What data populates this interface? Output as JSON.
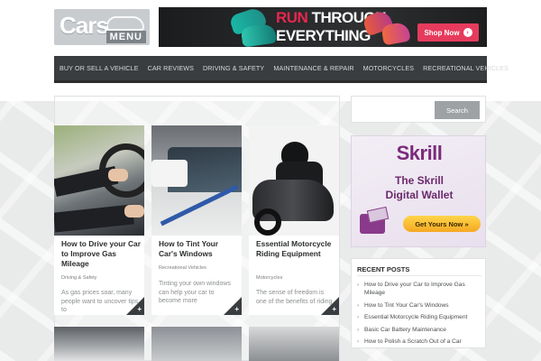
{
  "header": {
    "logo": {
      "word1": "Cars",
      "word2": "MENU"
    },
    "banner": {
      "line1a": "RUN",
      "line1b": "THROUGH",
      "line2": "EVERYTHING",
      "button": "Shop Now",
      "arrow": "›"
    }
  },
  "nav": {
    "items": [
      "Buy or Sell a Vehicle",
      "Car Reviews",
      "Driving & Safety",
      "Maintenance & Repair",
      "Motorcycles",
      "Recreational Vehicles"
    ]
  },
  "posts": [
    {
      "title": "How to Drive your Car to Improve Gas Mileage",
      "category": "Driving & Safety",
      "excerpt": "As gas prices soar, many people want to uncover tips to"
    },
    {
      "title": "How to Tint Your Car's Windows",
      "category": "Recreational Vehicles",
      "excerpt": "Tinting your own windows can help your car to become more"
    },
    {
      "title": "Essential Motorcycle Riding Equipment",
      "category": "Motorcycles",
      "excerpt": "The sense of freedom is one of the benefits of riding"
    }
  ],
  "card_plus": "+",
  "search": {
    "placeholder": "",
    "button": "Search"
  },
  "ad": {
    "brand": "Skrill",
    "line1": "The Skrill",
    "line2": "Digital Wallet",
    "cta": "Get Yours Now »"
  },
  "recent_posts": {
    "heading": "RECENT POSTS",
    "bullet": "›",
    "items": [
      "How to Drive your Car to Improve Gas Mileage",
      "How to Tint Your Car's Windows",
      "Essential Motorcycle Riding Equipment",
      "Basic Car Battery Maintenance",
      "How to Polish a Scratch Out of a Car"
    ]
  },
  "colors": {
    "nav_bg": "#3a3d40",
    "accent_red": "#e8264f",
    "skrill_purple": "#7b2b7c",
    "cta_yellow": "#f5a823"
  }
}
